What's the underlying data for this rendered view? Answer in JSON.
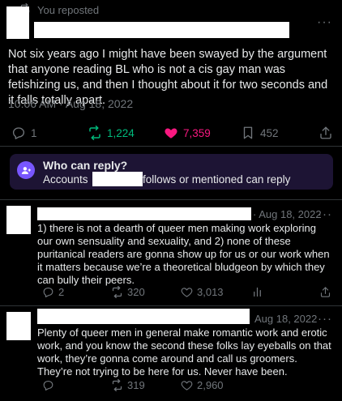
{
  "repost": {
    "text": "You reposted"
  },
  "main_tweet": {
    "more_label": "···",
    "body": "Not six years ago I might have been swayed by the argument that anyone reading BL who is not a cis gay man was fetishizing us, and then I thought about it for two seconds and it falls totally apart.",
    "timestamp": "10:06 AM · Aug 18, 2022",
    "stats": {
      "replies": "1",
      "reposts": "1,224",
      "likes": "7,359",
      "bookmarks": "452"
    }
  },
  "reply_restriction": {
    "title": "Who can reply?",
    "line_prefix": "Accounts",
    "line_suffix": "follows or mentioned can reply"
  },
  "replies": [
    {
      "date": "· Aug 18, 2022",
      "more_label": "···",
      "text": "1) there is not a dearth of queer men making work exploring our own sensuality and sexuality, and 2) none of these puritanical readers are gonna show up for us or our work when it matters because we’re a theoretical bludgeon by which they can bully their peers.",
      "replies": "2",
      "reposts": "320",
      "likes": "3,013"
    },
    {
      "date": "Aug 18, 2022",
      "more_label": "···",
      "text": "Plenty of queer men in general make romantic work and erotic work, and you know the second these folks lay eyeballs on that work, they’re gonna come around and call us groomers. They’re not trying to be here for us. Never have been.",
      "reposts": "319",
      "likes": "2,960"
    }
  ],
  "colors": {
    "background": "#000000",
    "text": "#e7e9ea",
    "muted": "#71767b",
    "repost_green": "#00ba7c",
    "like_pink": "#f91880",
    "reply_box_bg": "#1d1434",
    "reply_icon_bg": "#7856ff"
  }
}
